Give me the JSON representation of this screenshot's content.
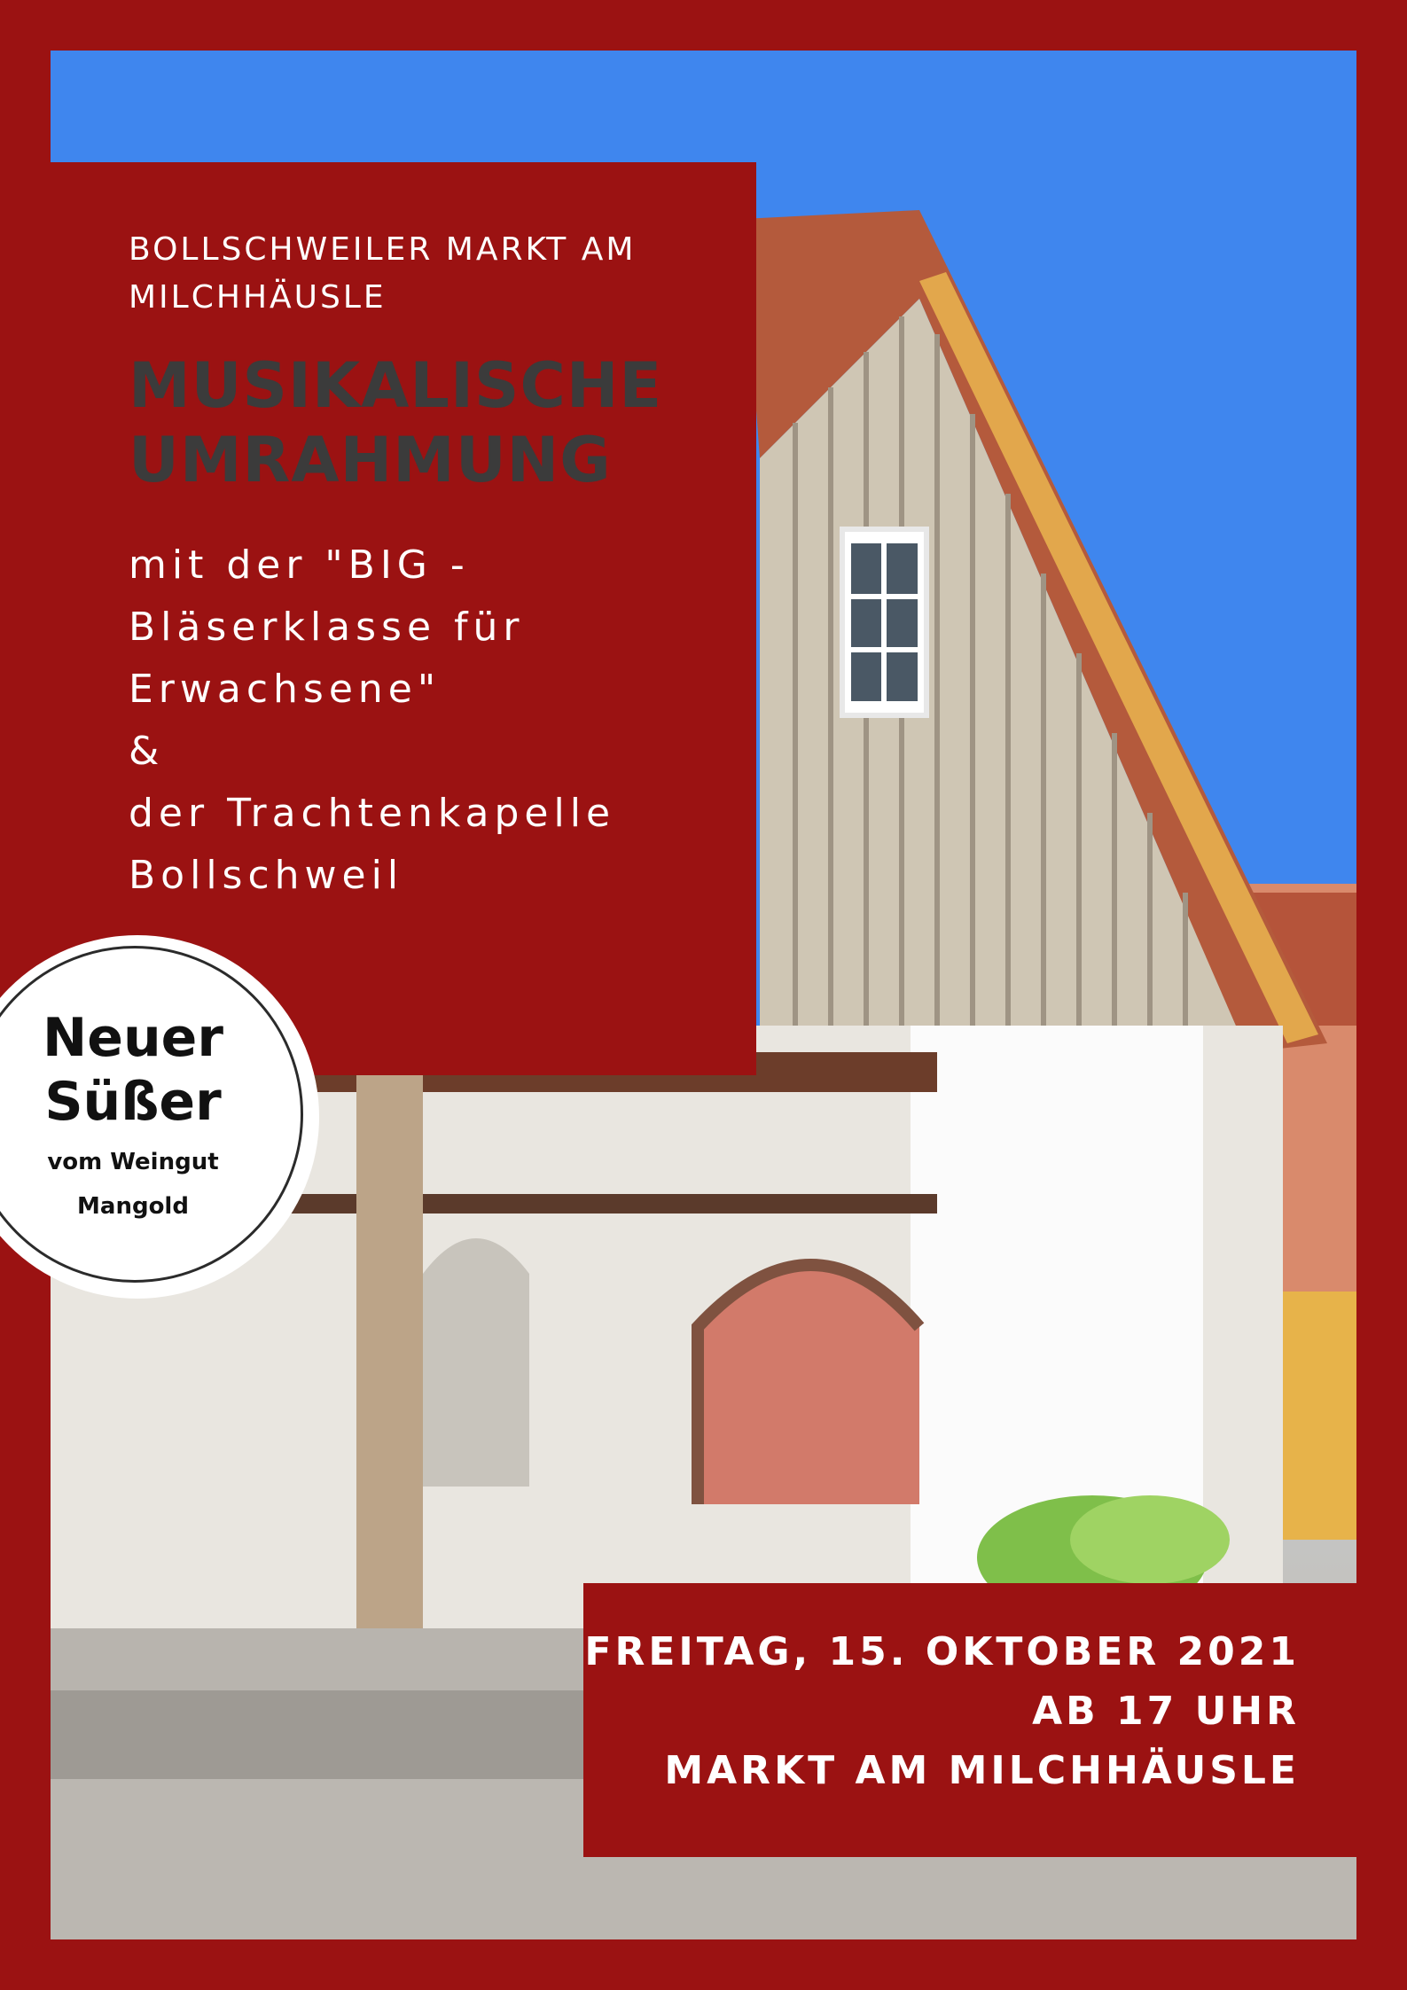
{
  "poster": {
    "kicker": "BOLLSCHWEILER MARKT AM MILCHHÄUSLE",
    "headline": [
      "MUSIKALISCHE",
      "UMRAHMUNG"
    ],
    "body_lines": [
      "mit der \"BIG -",
      "Bläserklasse für",
      "Erwachsene\"",
      "&",
      "der Trachtenkapelle",
      "Bollschweil"
    ],
    "badge": {
      "line1": "Neuer",
      "line2": "Süßer",
      "line3": "vom Weingut",
      "line4": "Mangold"
    },
    "event": {
      "date": "FREITAG, 15. OKTOBER 2021",
      "time": "AB 17 UHR",
      "place": "MARKT AM MILCHHÄUSLE"
    },
    "colors": {
      "brand_red": "#9b1212",
      "headline_gray": "#3b3b3b",
      "text_white": "#ffffff"
    }
  }
}
